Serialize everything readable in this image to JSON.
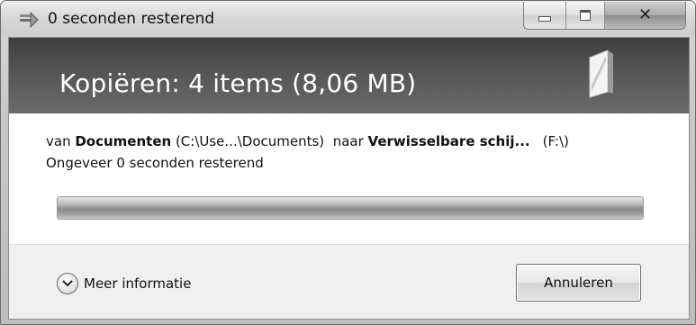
{
  "window": {
    "title": "0 seconden resterend"
  },
  "header": {
    "title": "Kopiëren: 4 items (8,06 MB)"
  },
  "details": {
    "prefix_van": "van ",
    "source_name": "Documenten",
    "source_path": " (C:\\Use...\\Documents)",
    "prefix_naar": "  naar ",
    "dest_name": "Verwisselbare schij...",
    "dest_path": "(F:\\)",
    "time_remaining": "Ongeveer 0 seconden resterend"
  },
  "progress": {
    "fraction": 1.0
  },
  "footer": {
    "more_info_label": "Meer informatie",
    "cancel_label": "Annuleren"
  },
  "icons": {
    "title_icon": "copy-files-icon",
    "header_icon": "removable-drive-icon",
    "more_info_icon": "chevron-down-icon"
  }
}
